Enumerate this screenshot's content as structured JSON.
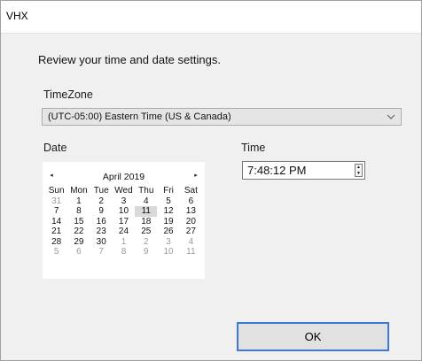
{
  "window": {
    "title": "VHX"
  },
  "prompt": "Review your time and date settings.",
  "timezone": {
    "label": "TimeZone",
    "value": "(UTC-05:00) Eastern Time (US & Canada)"
  },
  "date": {
    "label": "Date",
    "calendar": {
      "prev_icon": "◂",
      "next_icon": "▸",
      "month": "April 2019",
      "weekdays": [
        "Sun",
        "Mon",
        "Tue",
        "Wed",
        "Thu",
        "Fri",
        "Sat"
      ],
      "days": [
        {
          "d": "31",
          "other": true
        },
        {
          "d": "1"
        },
        {
          "d": "2"
        },
        {
          "d": "3"
        },
        {
          "d": "4"
        },
        {
          "d": "5"
        },
        {
          "d": "6"
        },
        {
          "d": "7"
        },
        {
          "d": "8"
        },
        {
          "d": "9"
        },
        {
          "d": "10"
        },
        {
          "d": "11",
          "selected": true
        },
        {
          "d": "12"
        },
        {
          "d": "13"
        },
        {
          "d": "14"
        },
        {
          "d": "15"
        },
        {
          "d": "16"
        },
        {
          "d": "17"
        },
        {
          "d": "18"
        },
        {
          "d": "19"
        },
        {
          "d": "20"
        },
        {
          "d": "21"
        },
        {
          "d": "22"
        },
        {
          "d": "23"
        },
        {
          "d": "24"
        },
        {
          "d": "25"
        },
        {
          "d": "26"
        },
        {
          "d": "27"
        },
        {
          "d": "28"
        },
        {
          "d": "29"
        },
        {
          "d": "30"
        },
        {
          "d": "1",
          "other": true
        },
        {
          "d": "2",
          "other": true
        },
        {
          "d": "3",
          "other": true
        },
        {
          "d": "4",
          "other": true
        },
        {
          "d": "5",
          "other": true
        },
        {
          "d": "6",
          "other": true
        },
        {
          "d": "7",
          "other": true
        },
        {
          "d": "8",
          "other": true
        },
        {
          "d": "9",
          "other": true
        },
        {
          "d": "10",
          "other": true
        },
        {
          "d": "11",
          "other": true
        }
      ]
    }
  },
  "time": {
    "label": "Time",
    "value": "7:48:12 PM",
    "up_icon": "▲",
    "down_icon": "▼"
  },
  "ok_label": "OK",
  "colors": {
    "accent": "#3d79d7",
    "selected_day": "#d9d9d9"
  }
}
